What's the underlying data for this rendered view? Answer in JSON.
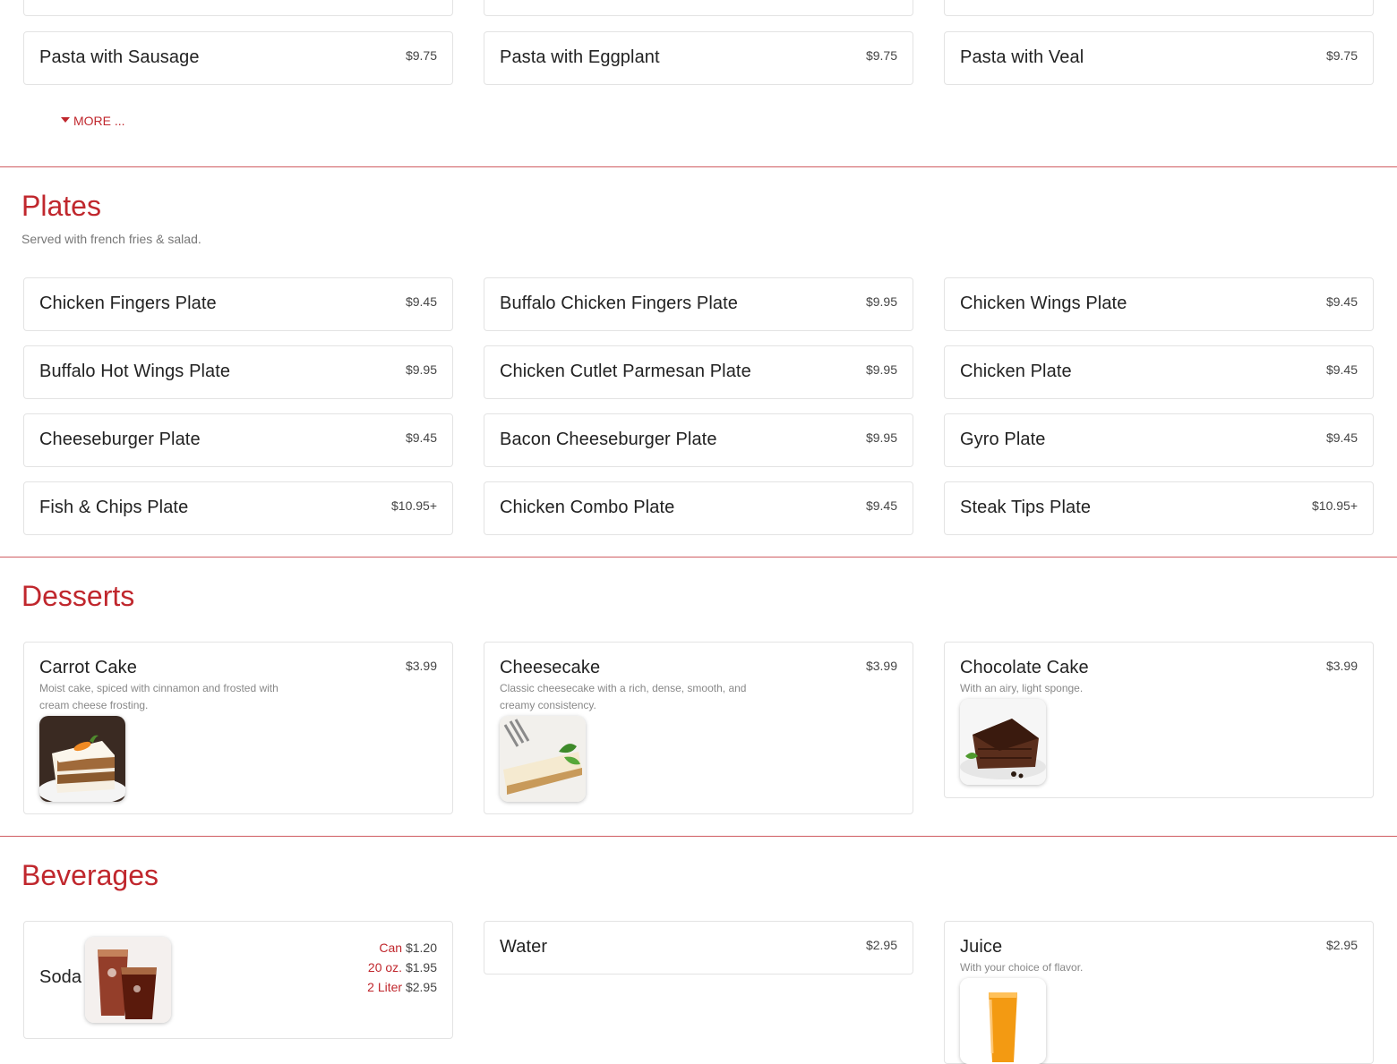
{
  "pasta": {
    "items": [
      {
        "name": "Pasta with Sausage",
        "price": "$9.75"
      },
      {
        "name": "Pasta with Eggplant",
        "price": "$9.75"
      },
      {
        "name": "Pasta with Veal",
        "price": "$9.75"
      }
    ],
    "more_label": "MORE ..."
  },
  "plates": {
    "title": "Plates",
    "subtitle": "Served with french fries & salad.",
    "items": [
      {
        "name": "Chicken Fingers Plate",
        "price": "$9.45"
      },
      {
        "name": "Buffalo Chicken Fingers Plate",
        "price": "$9.95"
      },
      {
        "name": "Chicken Wings Plate",
        "price": "$9.45"
      },
      {
        "name": "Buffalo Hot Wings Plate",
        "price": "$9.95"
      },
      {
        "name": "Chicken Cutlet Parmesan Plate",
        "price": "$9.95"
      },
      {
        "name": "Chicken Plate",
        "price": "$9.45"
      },
      {
        "name": "Cheeseburger Plate",
        "price": "$9.45"
      },
      {
        "name": "Bacon Cheeseburger Plate",
        "price": "$9.95"
      },
      {
        "name": "Gyro Plate",
        "price": "$9.45"
      },
      {
        "name": "Fish & Chips Plate",
        "price": "$10.95+"
      },
      {
        "name": "Chicken Combo Plate",
        "price": "$9.45"
      },
      {
        "name": "Steak Tips Plate",
        "price": "$10.95+"
      }
    ]
  },
  "desserts": {
    "title": "Desserts",
    "items": [
      {
        "name": "Carrot Cake",
        "price": "$3.99",
        "description": "Moist cake, spiced with cinnamon and frosted with cream cheese frosting.",
        "image": "carrot-cake-image"
      },
      {
        "name": "Cheesecake",
        "price": "$3.99",
        "description": "Classic cheesecake with a rich, dense, smooth, and creamy consistency.",
        "image": "cheesecake-image"
      },
      {
        "name": "Chocolate Cake",
        "price": "$3.99",
        "description": "With an airy, light sponge.",
        "image": "chocolate-cake-image"
      }
    ]
  },
  "beverages": {
    "title": "Beverages",
    "soda": {
      "name": "Soda",
      "image": "soda-image",
      "sizes": [
        {
          "size": "Can",
          "price": "$1.20"
        },
        {
          "size": "20 oz.",
          "price": "$1.95"
        },
        {
          "size": "2 Liter",
          "price": "$2.95"
        }
      ]
    },
    "water": {
      "name": "Water",
      "price": "$2.95"
    },
    "juice": {
      "name": "Juice",
      "price": "$2.95",
      "description": "With your choice of flavor.",
      "image": "juice-image"
    }
  },
  "colors": {
    "accent": "#c0272d",
    "border": "#e3e3e3",
    "muted": "#888888"
  }
}
